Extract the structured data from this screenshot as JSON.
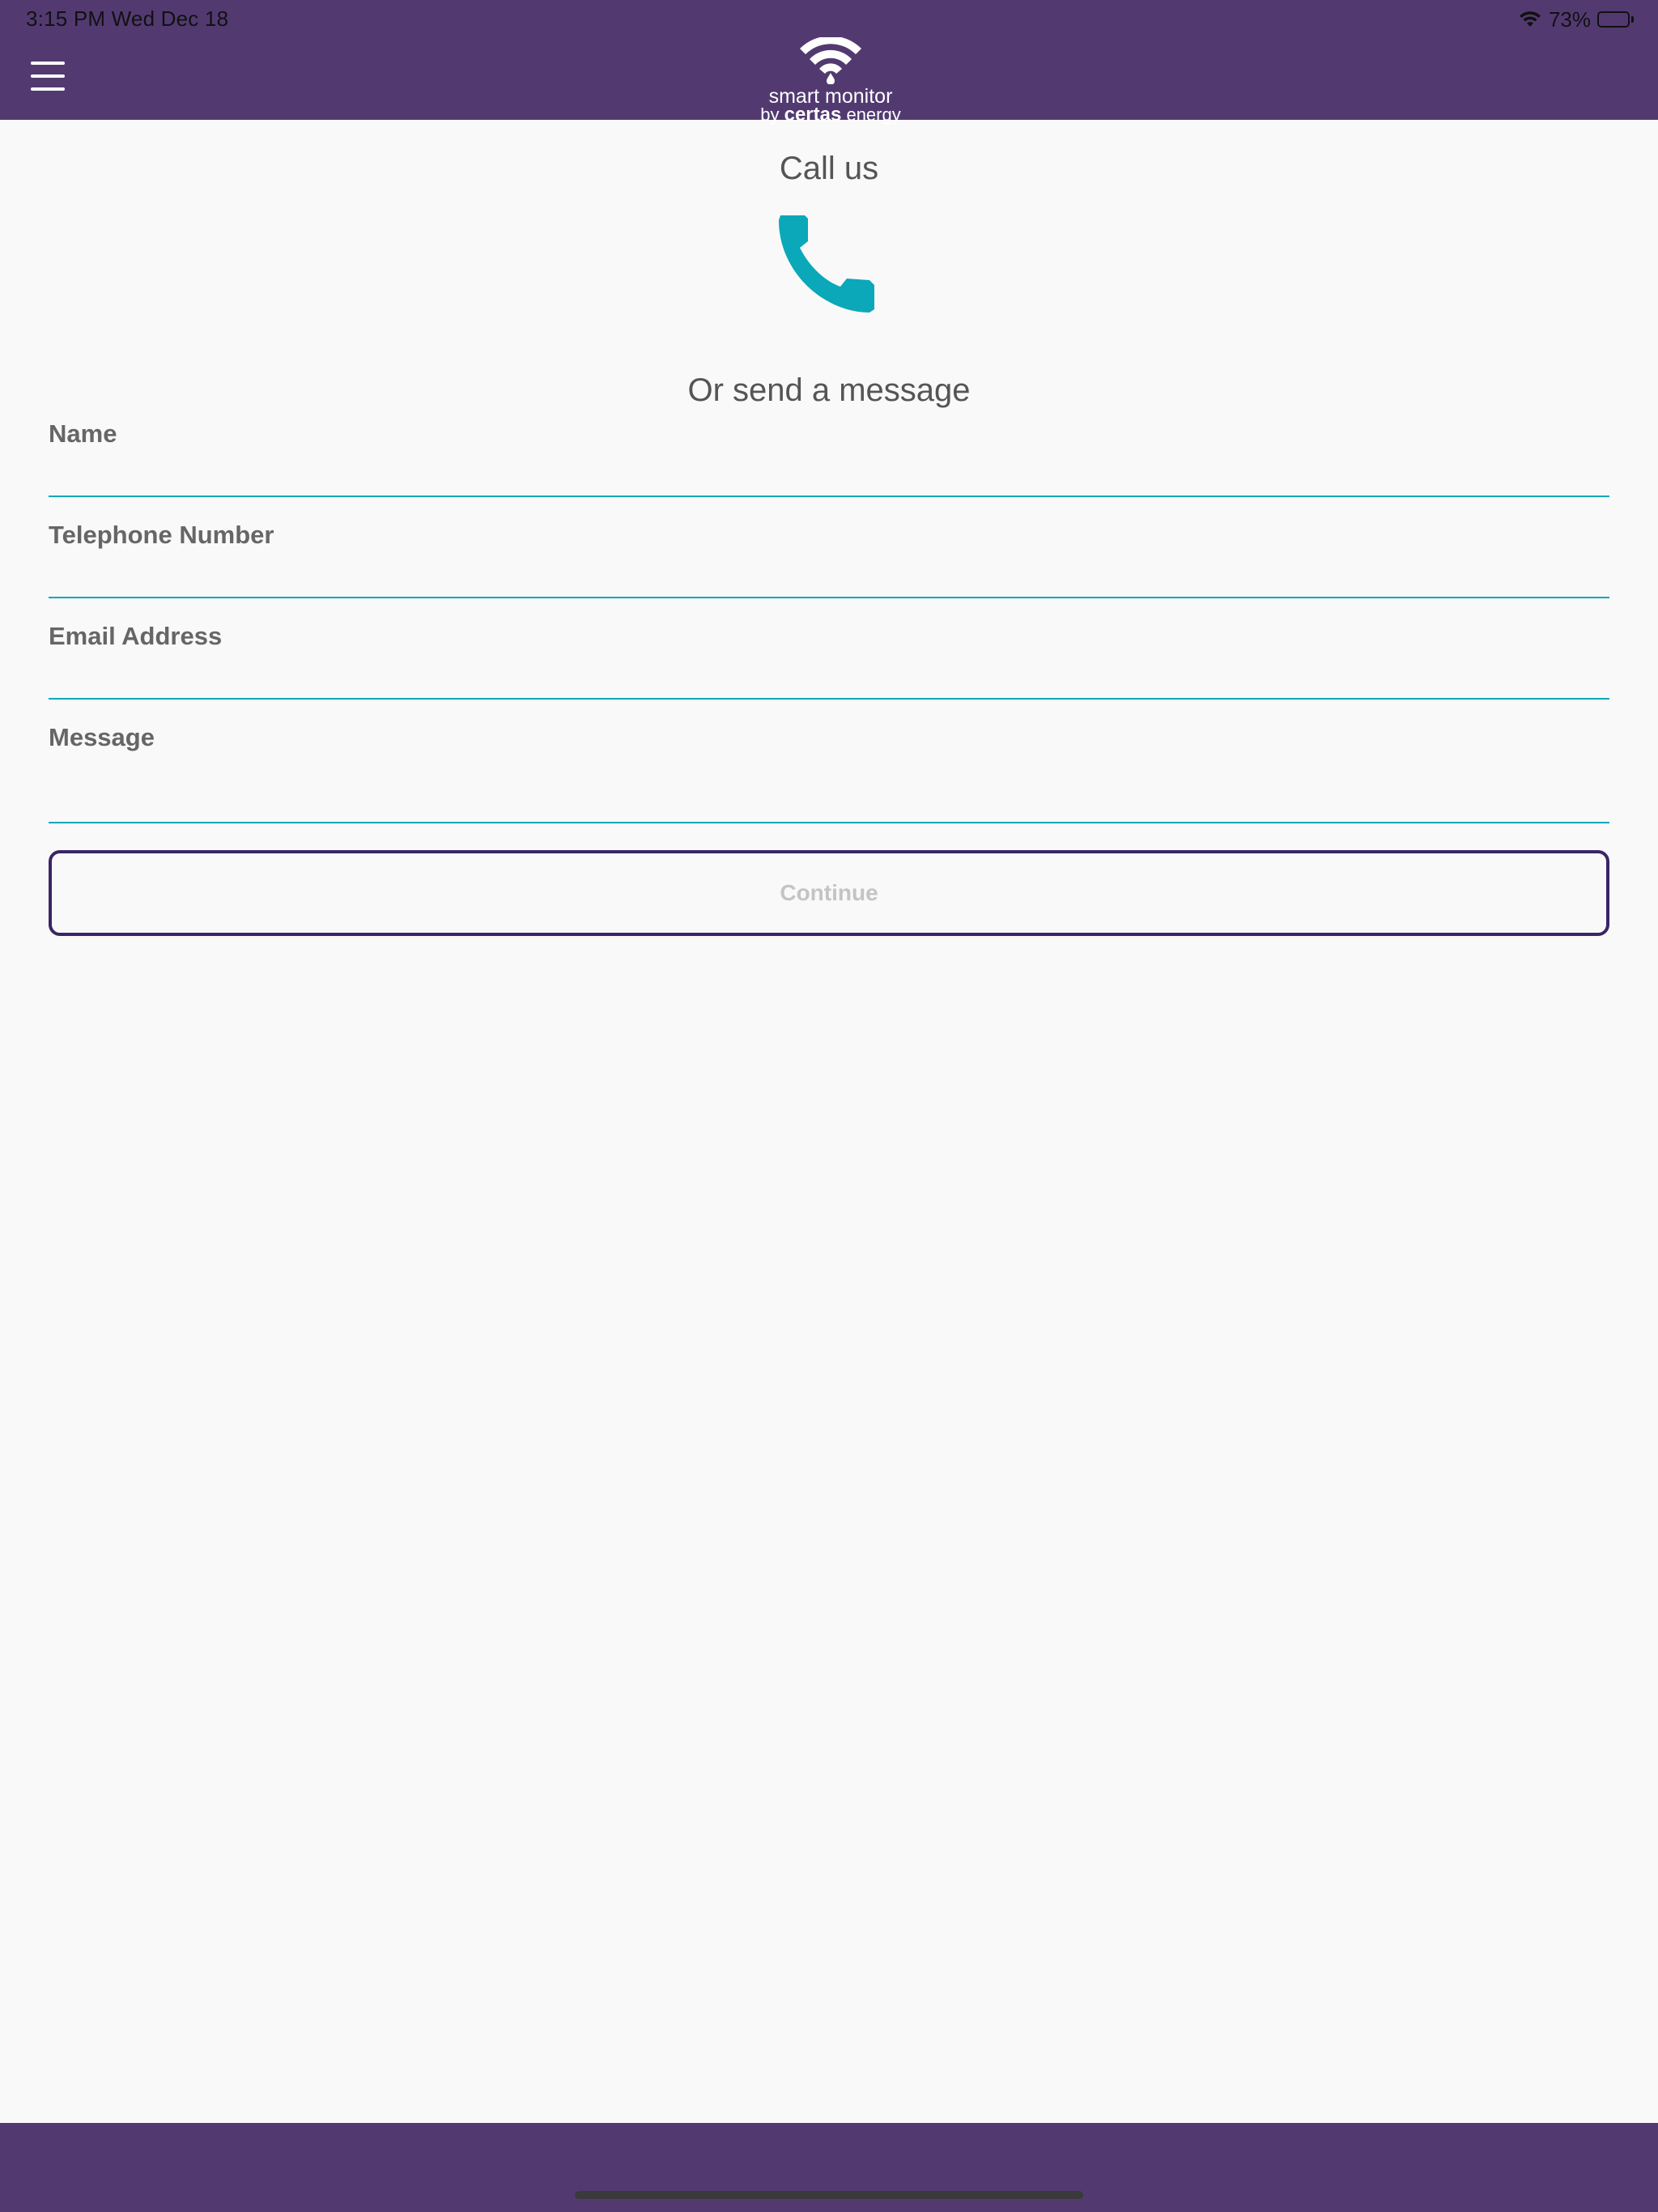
{
  "status_bar": {
    "time_date": "3:15 PM   Wed Dec 18",
    "battery": "73%",
    "battery_level": 0.73
  },
  "header": {
    "logo_line1": "smart monitor",
    "logo_by": "by ",
    "logo_brand": "certas",
    "logo_suffix": " energy",
    "background_color": "#523a71"
  },
  "call": {
    "title": "Call us",
    "icon": "phone-icon",
    "icon_color": "#0aa8b8"
  },
  "form": {
    "title": "Or send a message",
    "fields": [
      {
        "label": "Name",
        "value": ""
      },
      {
        "label": "Telephone Number",
        "value": ""
      },
      {
        "label": "Email Address",
        "value": ""
      },
      {
        "label": "Message",
        "value": ""
      }
    ],
    "continue_label": "Continue"
  }
}
